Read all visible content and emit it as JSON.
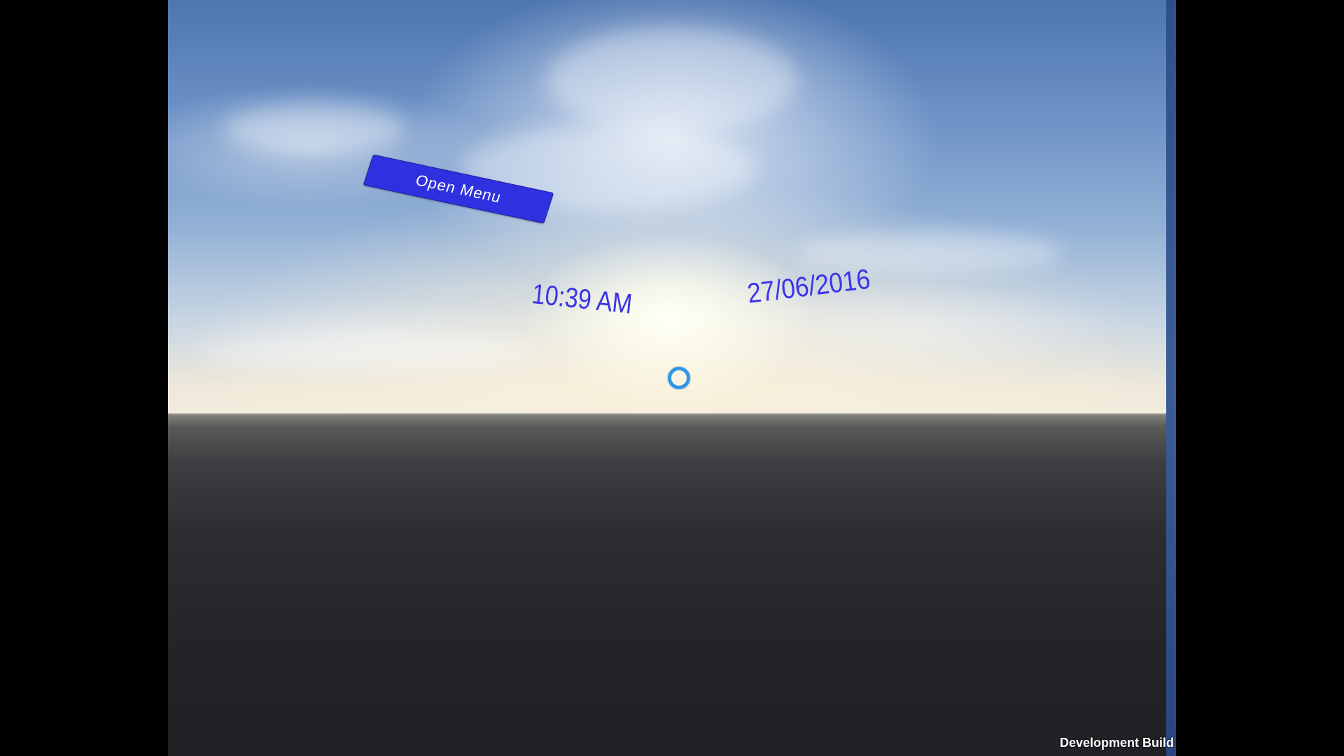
{
  "scene": {
    "open_menu_label": "Open Menu",
    "time": "10:39 AM",
    "date": "27/06/2016",
    "reticle_icon": "gaze-reticle-ring-icon"
  },
  "overlay": {
    "development_build": "Development Build"
  },
  "colors": {
    "button_fill": "#2f31e0",
    "world_text": "#3a34e8",
    "reticle": "#2f97e6",
    "sky_top": "#4d75b0",
    "ground": "#2c2d31"
  }
}
